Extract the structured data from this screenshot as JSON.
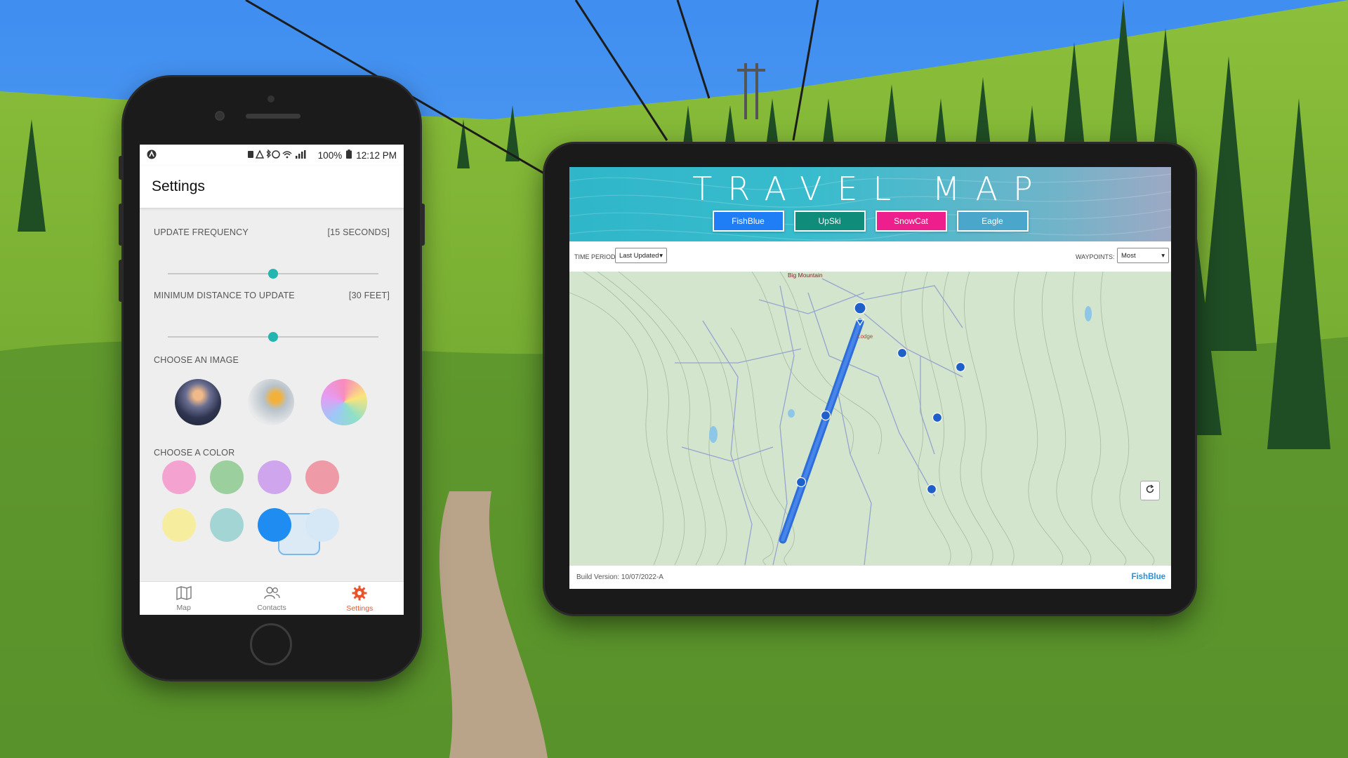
{
  "phone": {
    "status": {
      "battery": "100%",
      "time": "12:12 PM"
    },
    "title": "Settings",
    "update_frequency": {
      "label": "UPDATE FREQUENCY",
      "value": "[15 SECONDS]",
      "fraction": 0.5
    },
    "min_distance": {
      "label": "MINIMUM DISTANCE TO UPDATE",
      "value": "[30 FEET]",
      "fraction": 0.5
    },
    "choose_image_label": "CHOOSE AN IMAGE",
    "choose_color_label": "CHOOSE A COLOR",
    "colors": [
      "#f4a3d0",
      "#9ccf9e",
      "#cfa6ee",
      "#ee9aa7",
      "#f6ed9e",
      "#a3d5d4",
      "#1e8cf0",
      "#d6e8f6"
    ],
    "selected_color": "#1e8cf0",
    "tabs": [
      {
        "label": "Map",
        "icon": "map-icon"
      },
      {
        "label": "Contacts",
        "icon": "contacts-icon"
      },
      {
        "label": "Settings",
        "icon": "settings-gear-icon",
        "active": true
      }
    ]
  },
  "tablet": {
    "title": "TRAVEL MAP",
    "buttons": [
      {
        "label": "FishBlue",
        "color": "#1f7df5"
      },
      {
        "label": "UpSki",
        "color": "#0f8c7a"
      },
      {
        "label": "SnowCat",
        "color": "#ee1e8c"
      },
      {
        "label": "Eagle",
        "color": "#4aa6cb"
      }
    ],
    "time_period_label": "TIME PERIOD:",
    "time_period_value": "Last Updated",
    "waypoints_label": "WAYPOINTS:",
    "waypoints_value": "Most",
    "map": {
      "place_label": "Big Mountain",
      "lodge_label": "Lodge"
    },
    "build_version": "Build Version: 10/07/2022-A",
    "footer_user": "FishBlue"
  },
  "colors": {
    "accent_teal": "#23b5b0",
    "settings_active": "#e8552c",
    "track_blue": "#2e6ed8"
  }
}
